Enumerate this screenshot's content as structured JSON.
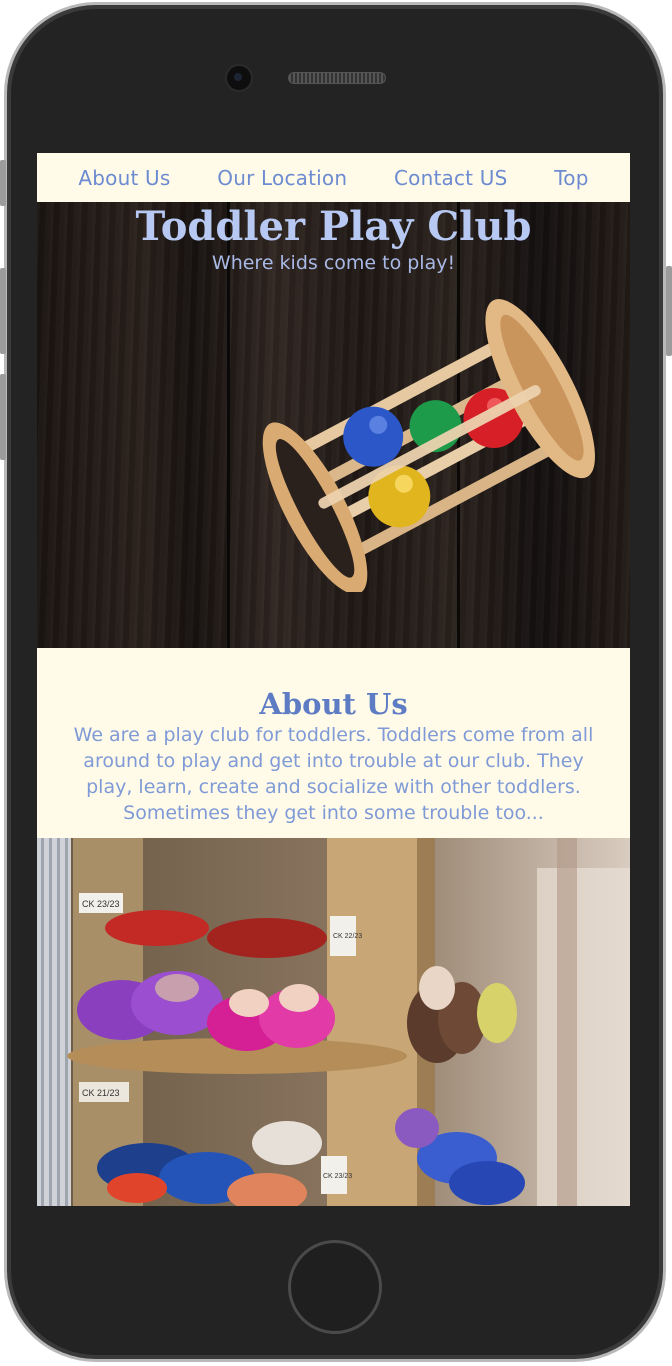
{
  "nav": {
    "items": [
      "About Us",
      "Our Location",
      "Contact US",
      "Top"
    ]
  },
  "hero": {
    "title": "Toddler Play Club",
    "subtitle": "Where kids come to play!",
    "image_icon": "wooden-rattle-toy"
  },
  "about": {
    "heading": "About Us",
    "body": "We are a play club for toddlers. Toddlers come from all around to play and get into trouble at our club. They play, learn, create and socialize with other toddlers. Sometimes they get into some trouble too..."
  },
  "shoes_image": {
    "icon": "baby-shoes-shelf",
    "box_labels": [
      "CK 23/23",
      "CK 22/23",
      "CK 21/23",
      "CK 23/23"
    ]
  },
  "colors": {
    "accent": "#6d8bd1",
    "background": "#fffbe8",
    "frame": "#232323"
  }
}
